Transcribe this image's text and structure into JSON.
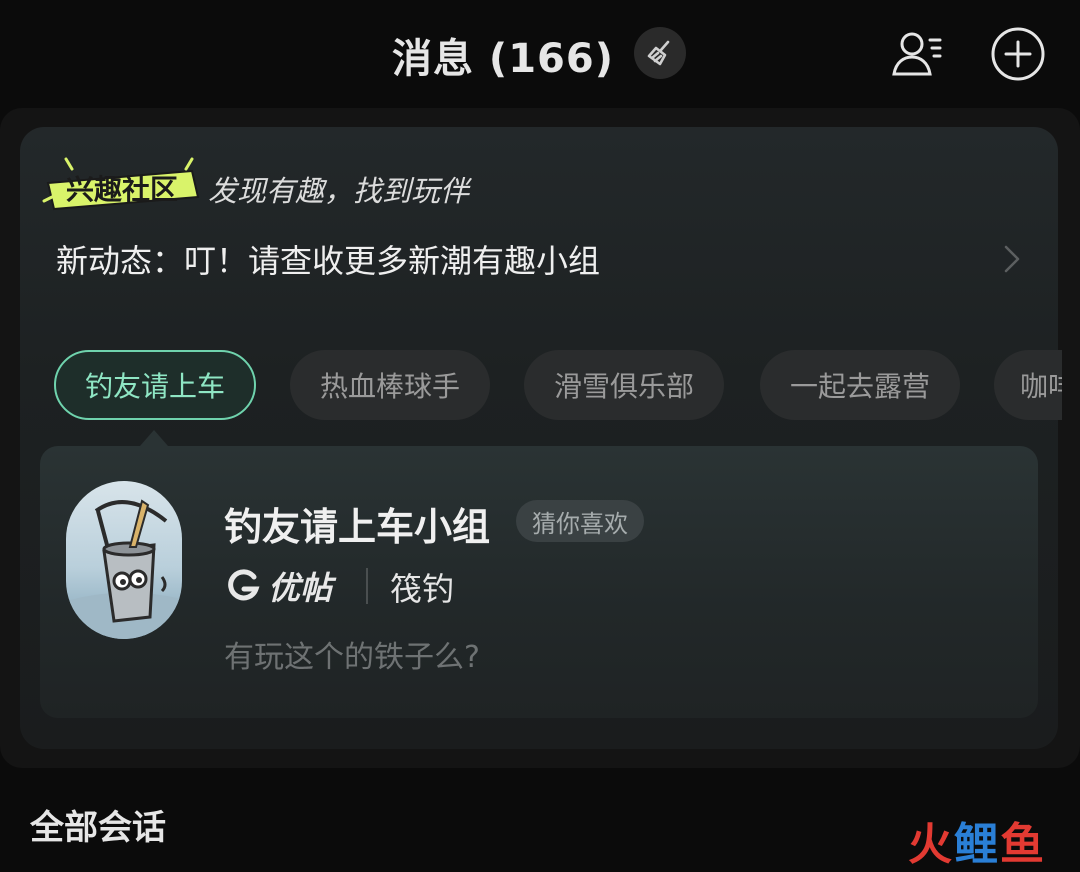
{
  "header": {
    "title": "消息 (166)",
    "icons": [
      "broom-icon",
      "contacts-icon",
      "add-circle-icon"
    ]
  },
  "community": {
    "logo_text": "兴趣社区",
    "slogan": "发现有趣，找到玩伴",
    "news": "新动态：叮！请查收更多新潮有趣小组"
  },
  "tags": [
    {
      "label": "钓友请上车",
      "active": true
    },
    {
      "label": "热血棒球手",
      "active": false
    },
    {
      "label": "滑雪俱乐部",
      "active": false
    },
    {
      "label": "一起去露营",
      "active": false
    },
    {
      "label": "咖啡",
      "active": false
    }
  ],
  "group": {
    "name": "钓友请上车小组",
    "badge": "猜你喜欢",
    "brand": "优帖",
    "category": "筏钓",
    "message": "有玩这个的铁子么?"
  },
  "section": {
    "title": "全部会话"
  },
  "watermark": {
    "text_red": "火",
    "text_blue": "鲤",
    "text_red2": "鱼"
  },
  "colors": {
    "accent": "#6fd3ad",
    "background": "#0b0b0b",
    "card": "#1d2122"
  }
}
